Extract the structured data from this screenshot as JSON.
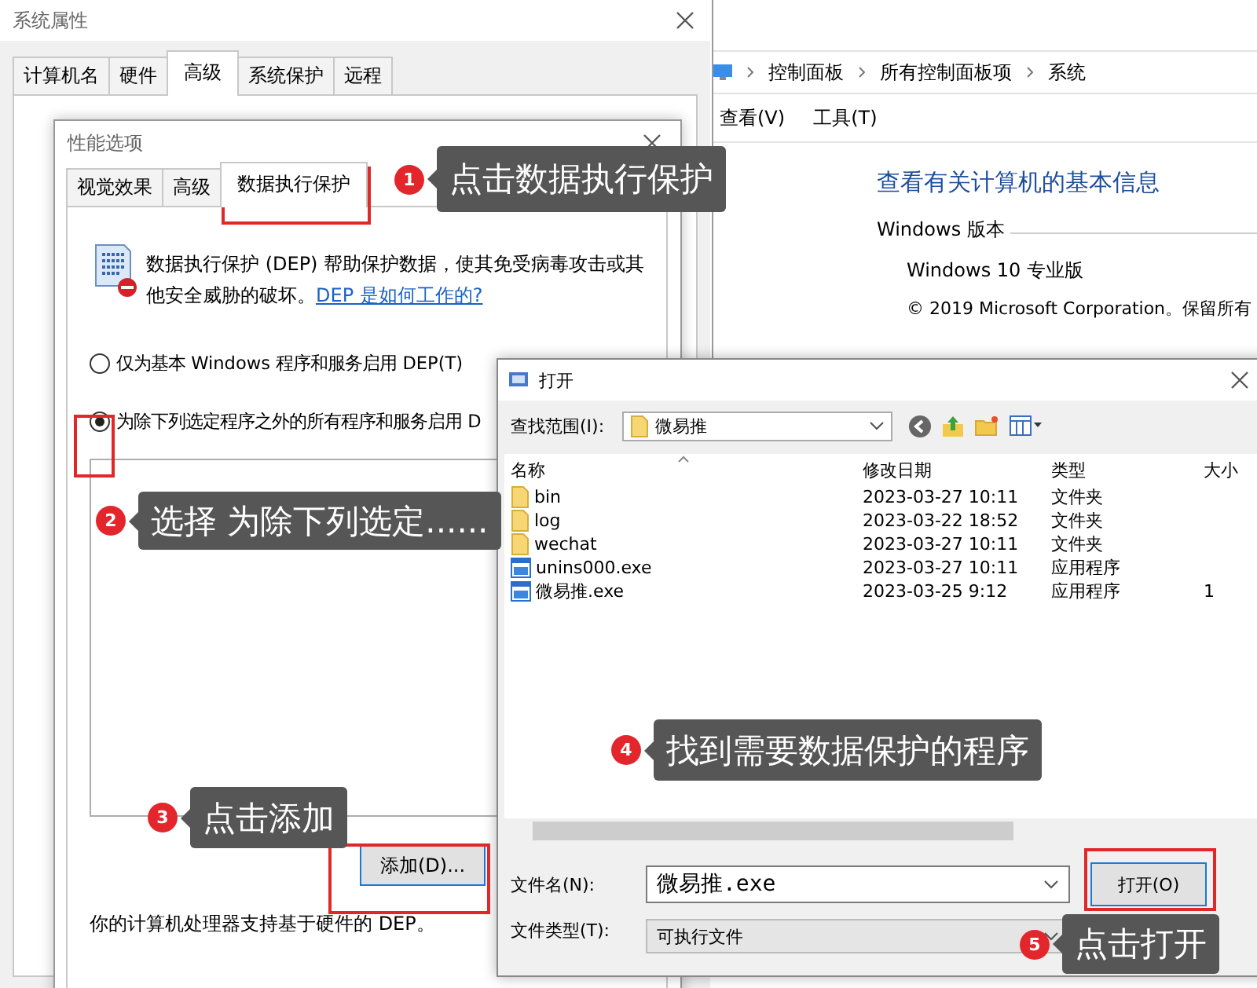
{
  "system_properties": {
    "title": "系统属性",
    "tabs": [
      {
        "label": "计算机名",
        "selected": false
      },
      {
        "label": "硬件",
        "selected": false
      },
      {
        "label": "高级",
        "selected": true
      },
      {
        "label": "系统保护",
        "selected": false
      },
      {
        "label": "远程",
        "selected": false
      }
    ]
  },
  "control_panel": {
    "breadcrumb": [
      "控制面板",
      "所有控制面板项",
      "系统"
    ],
    "menu": [
      "查看(V)",
      "工具(T)"
    ],
    "heading": "查看有关计算机的基本信息",
    "section": "Windows 版本",
    "edition": "Windows 10 专业版",
    "copyright": "© 2019 Microsoft Corporation。保留所有"
  },
  "performance_options": {
    "title": "性能选项",
    "tabs": [
      {
        "label": "视觉效果",
        "selected": false
      },
      {
        "label": "高级",
        "selected": false
      },
      {
        "label": "数据执行保护",
        "selected": true
      }
    ],
    "description": "数据执行保护 (DEP) 帮助保护数据，使其免受病毒攻击或其他安全威胁的破坏。",
    "link": "DEP 是如何工作的?",
    "options": [
      {
        "label": "仅为基本 Windows 程序和服务启用 DEP(T)",
        "selected": false
      },
      {
        "label": "为除下列选定程序之外的所有程序和服务启用 D",
        "selected": true
      }
    ],
    "add_button": "添加(D)...",
    "footer": "你的计算机处理器支持基于硬件的 DEP。"
  },
  "open_dialog": {
    "title": "打开",
    "look_in_label": "查找范围(I):",
    "look_in_value": "微易推",
    "columns": [
      "名称",
      "修改日期",
      "类型",
      "大小"
    ],
    "files": [
      {
        "kind": "folder",
        "name": "bin",
        "modified": "2023-03-27 10:11",
        "type": "文件夹"
      },
      {
        "kind": "folder",
        "name": "log",
        "modified": "2023-03-22 18:52",
        "type": "文件夹"
      },
      {
        "kind": "folder",
        "name": "wechat",
        "modified": "2023-03-27 10:11",
        "type": "文件夹"
      },
      {
        "kind": "program",
        "name": "unins000.exe",
        "modified": "2023-03-27 10:11",
        "type": "应用程序"
      },
      {
        "kind": "program",
        "name": "微易推.exe",
        "modified": "2023-03-25 9:12",
        "type": "应用程序",
        "size": "1"
      }
    ],
    "file_name_label": "文件名(N):",
    "file_name_value": "微易推.exe",
    "file_type_label": "文件类型(T):",
    "file_type_value": "可执行文件",
    "open_button": "打开(O)"
  },
  "steps": [
    {
      "number": "1",
      "text": "点击数据执行保护"
    },
    {
      "number": "2",
      "text": "选择 为除下列选定......"
    },
    {
      "number": "3",
      "text": "点击添加"
    },
    {
      "number": "4",
      "text": "找到需要数据保护的程序"
    },
    {
      "number": "5",
      "text": "点击打开"
    }
  ]
}
